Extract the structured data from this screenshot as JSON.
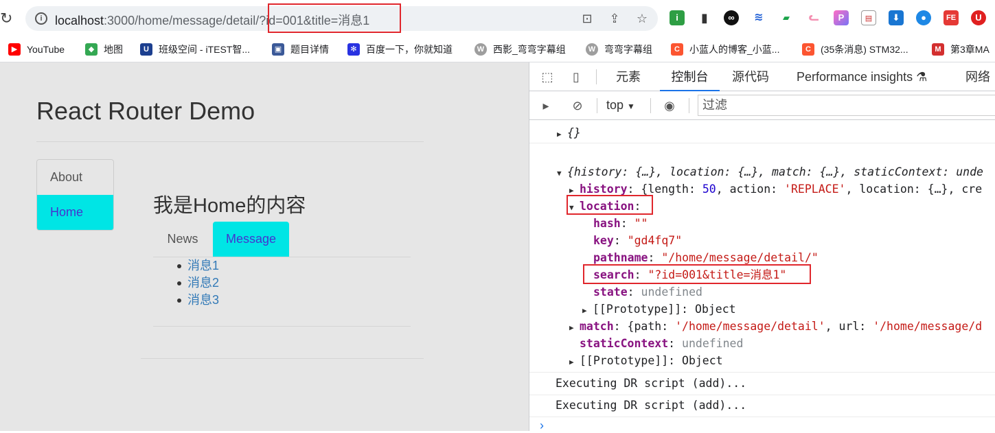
{
  "browser": {
    "url_host": "localhost",
    "url_rest": ":3000/home/message/detail/?id=001&title=消息1",
    "bookmarks": [
      {
        "label": "YouTube",
        "icon": "youtube-icon",
        "color": "#ff0000"
      },
      {
        "label": "地图",
        "icon": "maps-icon",
        "color": "#34a853"
      },
      {
        "label": "班级空间 - iTEST智...",
        "icon": "itest-icon",
        "color": "#1c3f8f"
      },
      {
        "label": "题目详情",
        "icon": "detail-icon",
        "color": "#3b5998"
      },
      {
        "label": "百度一下，你就知道",
        "icon": "baidu-icon",
        "color": "#2932e1"
      },
      {
        "label": "西影_弯弯字幕组",
        "icon": "w-icon",
        "color": "#9e9e9e"
      },
      {
        "label": "弯弯字幕组",
        "icon": "w-icon",
        "color": "#9e9e9e"
      },
      {
        "label": "小蓝人的博客_小蓝...",
        "icon": "csdn-icon",
        "color": "#fc5531"
      },
      {
        "label": "(35条消息) STM32...",
        "icon": "csdn-icon",
        "color": "#fc5531"
      },
      {
        "label": "第3章MA",
        "icon": "chapter-icon",
        "color": "#d32f2f"
      }
    ]
  },
  "app": {
    "title": "React Router Demo",
    "nav": {
      "about": "About",
      "home": "Home"
    },
    "home_heading": "我是Home的内容",
    "tabs": {
      "news": "News",
      "message": "Message"
    },
    "messages": [
      "消息1",
      "消息2",
      "消息3"
    ]
  },
  "devtools": {
    "tabs": [
      "元素",
      "控制台",
      "源代码",
      "Performance insights",
      "网络"
    ],
    "active_tab": "控制台",
    "context": "top",
    "filter_placeholder": "过滤",
    "console": {
      "obj_empty": "{}",
      "obj_summary": "{history: {…}, location: {…}, match: {…}, staticContext: unde",
      "history_key": "history",
      "history_val_a": "{length: ",
      "history_len": "50",
      "history_val_b": ", action: ",
      "history_action": "'REPLACE'",
      "history_val_c": ", location: {…}, cre",
      "location_key": "location",
      "hash_key": "hash",
      "hash_val": "\"\"",
      "key_key": "key",
      "key_val": "\"gd4fq7\"",
      "pathname_key": "pathname",
      "pathname_val": "\"/home/message/detail/\"",
      "search_key": "search",
      "search_val": "\"?id=001&title=消息1\"",
      "state_key": "state",
      "state_val": "undefined",
      "proto1": "[[Prototype]]: Object",
      "match_key": "match",
      "match_val_a": "{path: ",
      "match_path": "'/home/message/detail'",
      "match_val_b": ", url: ",
      "match_url": "'/home/message/d",
      "static_key": "staticContext",
      "static_val": "undefined",
      "proto2": "[[Prototype]]: Object",
      "exec1": "Executing DR script (add)...",
      "exec2": "Executing DR script (add)..."
    }
  }
}
